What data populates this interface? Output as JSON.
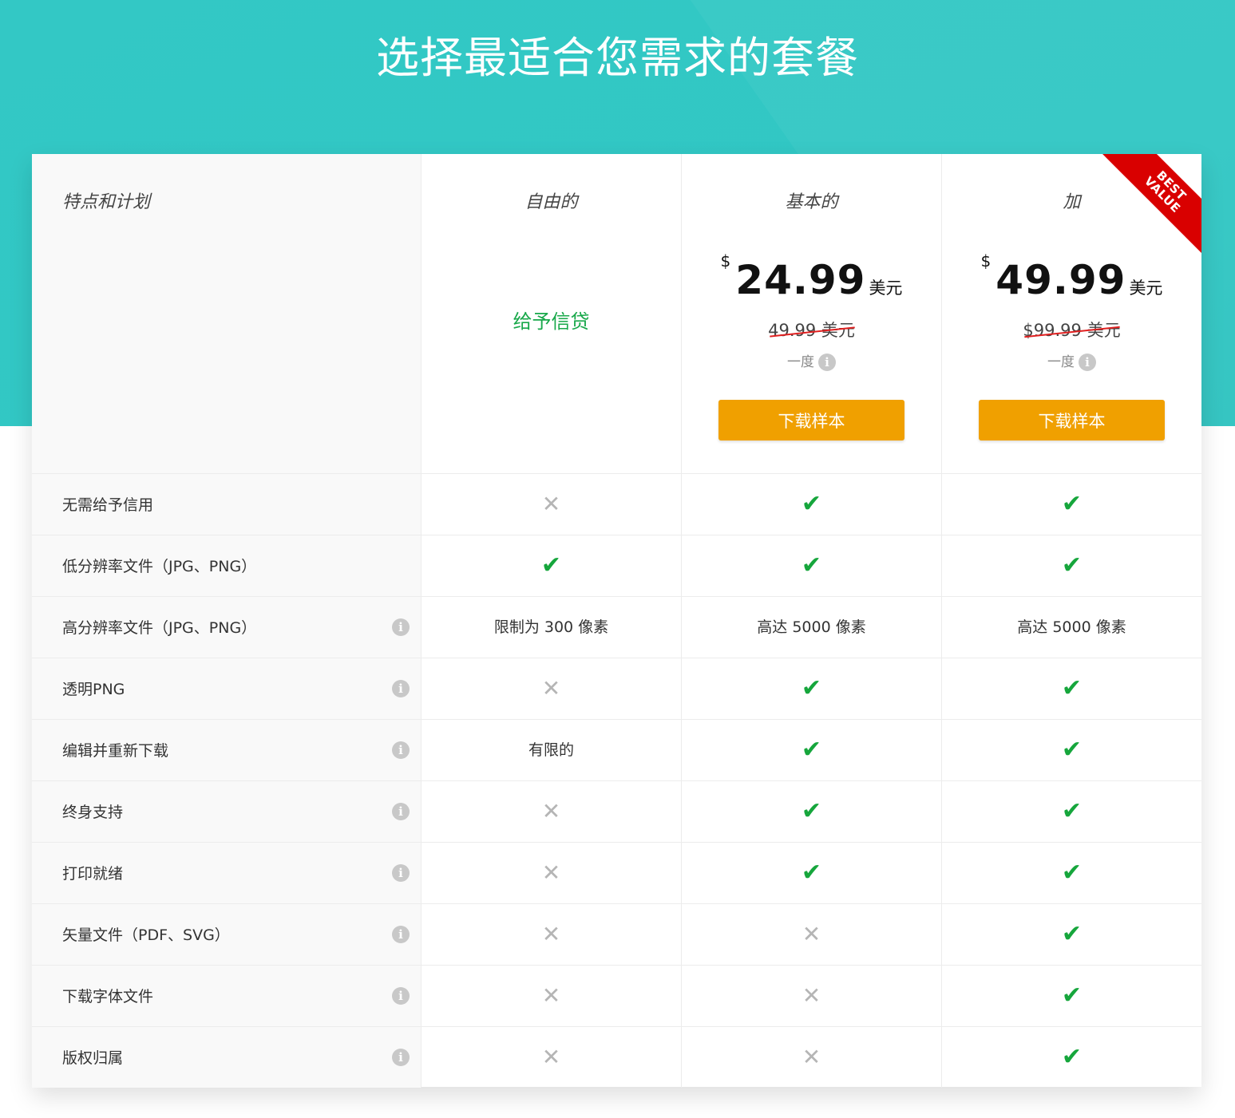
{
  "page": {
    "title": "选择最适合您需求的套餐"
  },
  "header": {
    "feature_label": "特点和计划",
    "plans": [
      {
        "name": "自由的",
        "credit_text": "给予信贷"
      },
      {
        "name": "基本的",
        "currency": "$",
        "price": "24.99",
        "unit": "美元",
        "old_price": "49.99 美元",
        "billing": "一度",
        "button": "下载样本"
      },
      {
        "name": "加",
        "currency": "$",
        "price": "49.99",
        "unit": "美元",
        "old_price": "$99.99 美元",
        "billing": "一度",
        "button": "下载样本",
        "ribbon": "BEST VALUE"
      }
    ]
  },
  "icons": {
    "info": "info-icon",
    "yes": "check-icon",
    "no": "cross-icon"
  },
  "symbols": {
    "yes": "✔",
    "no": "✕",
    "info": "i"
  },
  "colors": {
    "hero": "#31c7c4",
    "button": "#f0a000",
    "check": "#16a63c",
    "ribbon": "#d90000",
    "credit": "#18a84a"
  },
  "rows": [
    {
      "label": "无需给予信用",
      "info": false,
      "values": [
        "no",
        "yes",
        "yes"
      ]
    },
    {
      "label": "低分辨率文件（JPG、PNG）",
      "info": false,
      "values": [
        "yes",
        "yes",
        "yes"
      ]
    },
    {
      "label": "高分辨率文件（JPG、PNG）",
      "info": true,
      "values": [
        "限制为 300 像素",
        "高达 5000 像素",
        "高达 5000 像素"
      ]
    },
    {
      "label": "透明PNG",
      "info": true,
      "values": [
        "no",
        "yes",
        "yes"
      ]
    },
    {
      "label": "编辑并重新下载",
      "info": true,
      "values": [
        "有限的",
        "yes",
        "yes"
      ]
    },
    {
      "label": "终身支持",
      "info": true,
      "values": [
        "no",
        "yes",
        "yes"
      ]
    },
    {
      "label": "打印就绪",
      "info": true,
      "values": [
        "no",
        "yes",
        "yes"
      ]
    },
    {
      "label": "矢量文件（PDF、SVG）",
      "info": true,
      "values": [
        "no",
        "no",
        "yes"
      ]
    },
    {
      "label": "下载字体文件",
      "info": true,
      "values": [
        "no",
        "no",
        "yes"
      ]
    },
    {
      "label": "版权归属",
      "info": true,
      "values": [
        "no",
        "no",
        "yes"
      ]
    }
  ]
}
